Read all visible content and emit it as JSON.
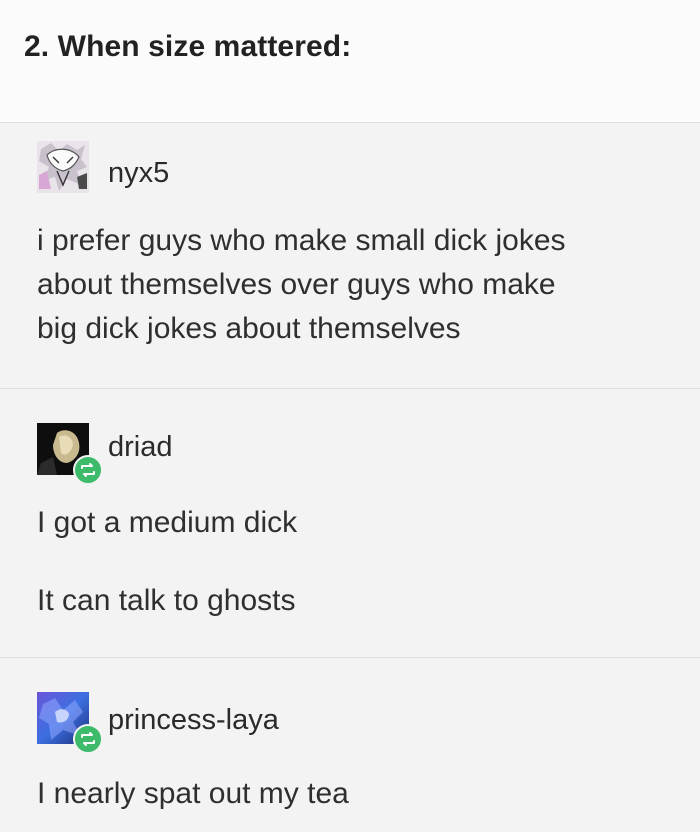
{
  "heading": "2. When size mattered:",
  "posts": [
    {
      "username": "nyx5",
      "avatar_icon": "anime-character-avatar-icon",
      "text_lines": [
        "i prefer guys who make small dick jokes",
        "about themselves over guys who make",
        "big dick jokes about themselves"
      ]
    },
    {
      "username": "driad",
      "avatar_icon": "dark-portrait-avatar-icon",
      "reblog_icon": "reblog-icon",
      "text_lines": [
        "I got a medium dick",
        "It can talk to ghosts"
      ]
    },
    {
      "username": "princess-laya",
      "avatar_icon": "blue-purple-avatar-icon",
      "reblog_icon": "reblog-icon",
      "text_lines": [
        "I nearly spat out my tea"
      ]
    }
  ],
  "colors": {
    "card_background": "#f3f3f3",
    "reblog_badge": "#3dbb6b",
    "text": "#2f2f2f"
  }
}
